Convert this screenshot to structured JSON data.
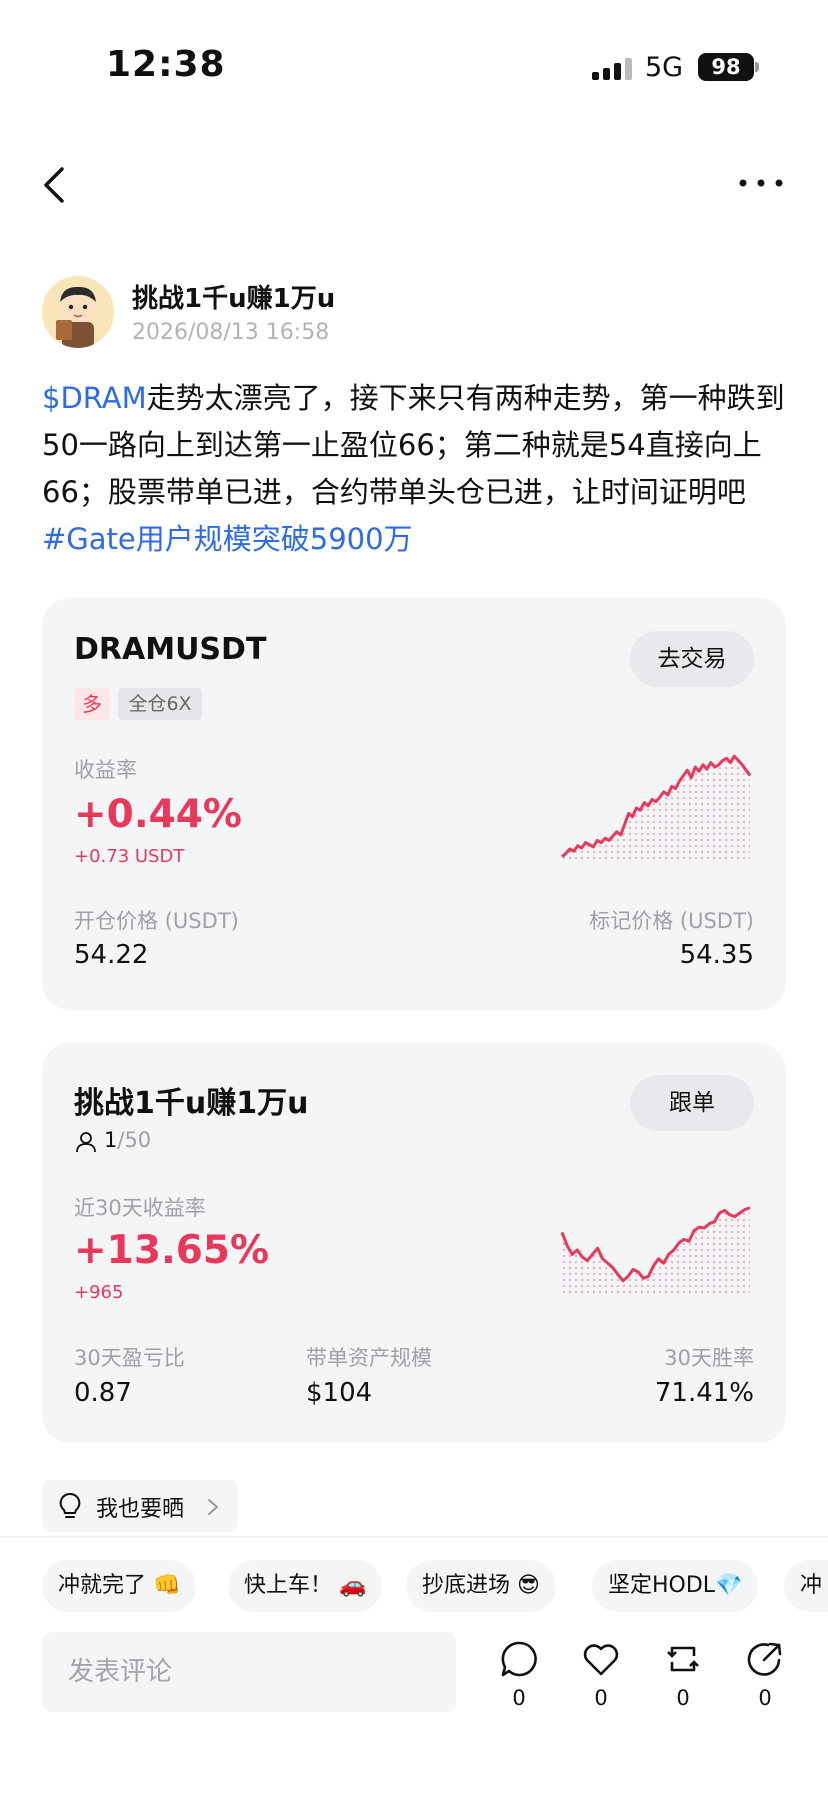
{
  "status": {
    "time": "12:38",
    "network": "5G",
    "battery": "98"
  },
  "post": {
    "author": "挑战1千u赚1万u",
    "date": "2026/08/13 16:58",
    "ticker": "$DRAM",
    "body": "走势太漂亮了，接下来只有两种走势，第一种跌到50一路向上到达第一止盈位66；第二种就是54直接向上66；股票带单已进，合约带单头仓已进，让时间证明吧",
    "hashtag": "#Gate用户规模突破5900万"
  },
  "position_card": {
    "symbol": "DRAMUSDT",
    "trade_label": "去交易",
    "side": "多",
    "mode": "全仓6X",
    "pnl_rate_label": "收益率",
    "pnl_rate": "+0.44%",
    "pnl_amount": "+0.73 USDT",
    "entry_label": "开仓价格 (USDT)",
    "entry_price": "54.22",
    "mark_label": "标记价格 (USDT)",
    "mark_price": "54.35",
    "sparkline": [
      0.05,
      0.08,
      0.12,
      0.1,
      0.15,
      0.13,
      0.18,
      0.16,
      0.14,
      0.2,
      0.18,
      0.22,
      0.2,
      0.24,
      0.28,
      0.25,
      0.35,
      0.45,
      0.42,
      0.5,
      0.48,
      0.55,
      0.52,
      0.58,
      0.56,
      0.6,
      0.65,
      0.62,
      0.7,
      0.68,
      0.75,
      0.8,
      0.85,
      0.78,
      0.88,
      0.84,
      0.9,
      0.86,
      0.92,
      0.88,
      0.9,
      0.94,
      0.96,
      0.92,
      0.98,
      0.94,
      0.9,
      0.85,
      0.8
    ]
  },
  "copy_card": {
    "title": "挑战1千u赚1万u",
    "follow_label": "跟单",
    "followers": "1",
    "followers_cap": "/50",
    "roi_label": "近30天收益率",
    "roi": "+13.65%",
    "profit": "+965",
    "stats": [
      {
        "label": "30天盈亏比",
        "value": "0.87"
      },
      {
        "label": "带单资产规模",
        "value": "$104"
      },
      {
        "label": "30天胜率",
        "value": "71.41%"
      }
    ],
    "sparkline": [
      0.7,
      0.55,
      0.45,
      0.5,
      0.42,
      0.38,
      0.45,
      0.52,
      0.4,
      0.35,
      0.3,
      0.22,
      0.15,
      0.2,
      0.28,
      0.25,
      0.18,
      0.2,
      0.32,
      0.4,
      0.35,
      0.45,
      0.5,
      0.58,
      0.62,
      0.6,
      0.72,
      0.76,
      0.75,
      0.8,
      0.82,
      0.92,
      0.95,
      0.9,
      0.88,
      0.92,
      0.96,
      0.98
    ]
  },
  "share": {
    "label": "我也要晒"
  },
  "chips": [
    "冲就完了 👊",
    "快上车！ 🚗",
    "抄底进场 😎",
    "坚定HODL💎",
    "冲"
  ],
  "comment": {
    "placeholder": "发表评论",
    "counts": {
      "comments": "0",
      "likes": "0",
      "reposts": "0",
      "shares": "0"
    }
  }
}
